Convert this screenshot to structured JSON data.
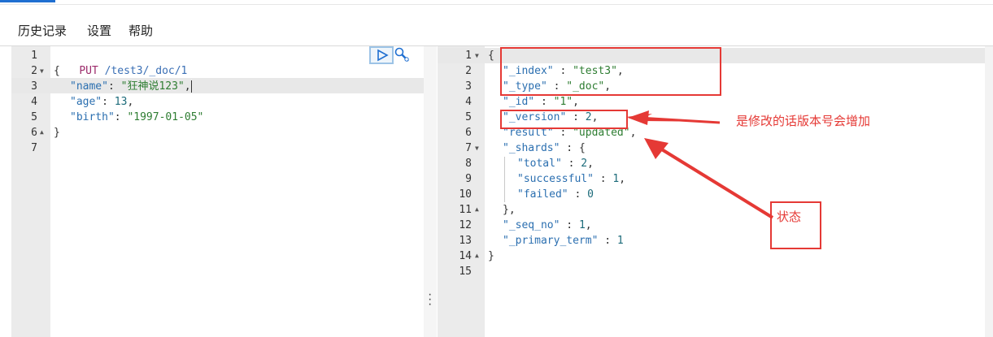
{
  "menu": {
    "history": "历史记录",
    "settings": "设置",
    "help": "帮助"
  },
  "request": {
    "line_numbers": [
      "1",
      "2",
      "3",
      "4",
      "5",
      "6",
      "7"
    ],
    "method": "PUT",
    "path": "/test3/_doc/1",
    "open_brace": "{",
    "close_brace": "}",
    "fields": [
      {
        "key": "\"name\"",
        "value": "\"狂神说123\"",
        "comma": ","
      },
      {
        "key": "\"age\"",
        "value": "13",
        "comma": ","
      },
      {
        "key": "\"birth\"",
        "value": "\"1997-01-05\"",
        "comma": ""
      }
    ]
  },
  "response": {
    "line_numbers": [
      "1",
      "2",
      "3",
      "4",
      "5",
      "6",
      "7",
      "8",
      "9",
      "10",
      "11",
      "12",
      "13",
      "14",
      "15"
    ],
    "open_brace": "{",
    "close_brace": "}",
    "shards_close": "},",
    "lines": [
      {
        "key": "\"_index\"",
        "value": "\"test3\"",
        "comma": ","
      },
      {
        "key": "\"_type\"",
        "value": "\"_doc\"",
        "comma": ","
      },
      {
        "key": "\"_id\"",
        "value": "\"1\"",
        "comma": ","
      },
      {
        "key": "\"_version\"",
        "value": "2",
        "comma": ","
      },
      {
        "key": "\"result\"",
        "value": "\"updated\"",
        "comma": ","
      },
      {
        "key": "\"_shards\"",
        "value": "{",
        "comma": ""
      },
      {
        "key": "\"total\"",
        "value": "2",
        "comma": ","
      },
      {
        "key": "\"successful\"",
        "value": "1",
        "comma": ","
      },
      {
        "key": "\"failed\"",
        "value": "0",
        "comma": ""
      },
      {
        "key": "\"_seq_no\"",
        "value": "1",
        "comma": ","
      },
      {
        "key": "\"_primary_term\"",
        "value": "1",
        "comma": ""
      }
    ]
  },
  "annotations": {
    "version_note": "是修改的话版本号会增加",
    "status_note": "状态"
  },
  "colors": {
    "annotation": "#e53935",
    "accent": "#1f6fd1"
  },
  "icons": {
    "run": "play-icon",
    "wrench": "wrench-icon"
  }
}
